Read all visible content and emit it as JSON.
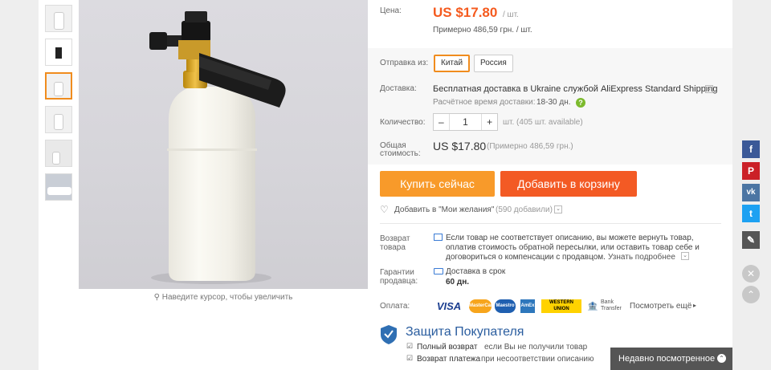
{
  "gallery": {
    "zoom_hint": "Наведите курсор, чтобы увеличить"
  },
  "price": {
    "label": "Цена:",
    "value": "US $17.80",
    "unit": "/ шт.",
    "approx": "Примерно 486,59 грн. / шт."
  },
  "shipping": {
    "from_label": "Отправка из:",
    "from_options": [
      "Китай",
      "Россия"
    ],
    "delivery_label": "Доставка:",
    "delivery_text": "Бесплатная доставка в Ukraine службой AliExpress Standard Shipping",
    "estimate_label": "Расчётное время доставки:",
    "estimate_value": "18-30 дн."
  },
  "quantity": {
    "label": "Количество:",
    "minus": "–",
    "value": "1",
    "plus": "+",
    "available": "шт. (405 шт. available)"
  },
  "total": {
    "label_line1": "Общая",
    "label_line2": "стоимость:",
    "value": "US $17.80",
    "approx": "(Примерно 486,59 грн.)"
  },
  "actions": {
    "buy_now": "Купить сейчас",
    "add_to_cart": "Добавить в корзину",
    "wishlist": "Добавить в \"Мои желания\"",
    "wishlist_count": "(590 добавили)"
  },
  "returns": {
    "label_line1": "Возврат",
    "label_line2": "товара",
    "text_line1": "Если товар не соответствует описанию, вы можете вернуть товар,",
    "text_line2": "оплатив стоимость обратной пересылки, или оставить товар себе и",
    "text_line3": "договориться о компенсации с продавцом.",
    "link": "Узнать подробнее"
  },
  "guarantee": {
    "label_line1": "Гарантии",
    "label_line2": "продавца:",
    "text": "Доставка в срок",
    "days": "60 дн."
  },
  "payment": {
    "label": "Оплата:",
    "methods": [
      "VISA",
      "MasterCard",
      "Maestro",
      "AmEx",
      "WESTERN UNION",
      "Bank Transfer"
    ],
    "more": "Посмотреть ещё"
  },
  "protection": {
    "title": "Защита Покупателя",
    "item1_bold": "Полный возврат",
    "item1_rest": "если Вы не получили товар",
    "item2_bold": "Возврат платежа",
    "item2_rest": "при несоответствии описанию"
  },
  "recently_viewed": "Недавно посмотренное",
  "colors": {
    "accent": "#f08c1e",
    "price": "#f55a1e",
    "buy_now": "#f89a2a",
    "add_to_cart": "#f35a24"
  }
}
